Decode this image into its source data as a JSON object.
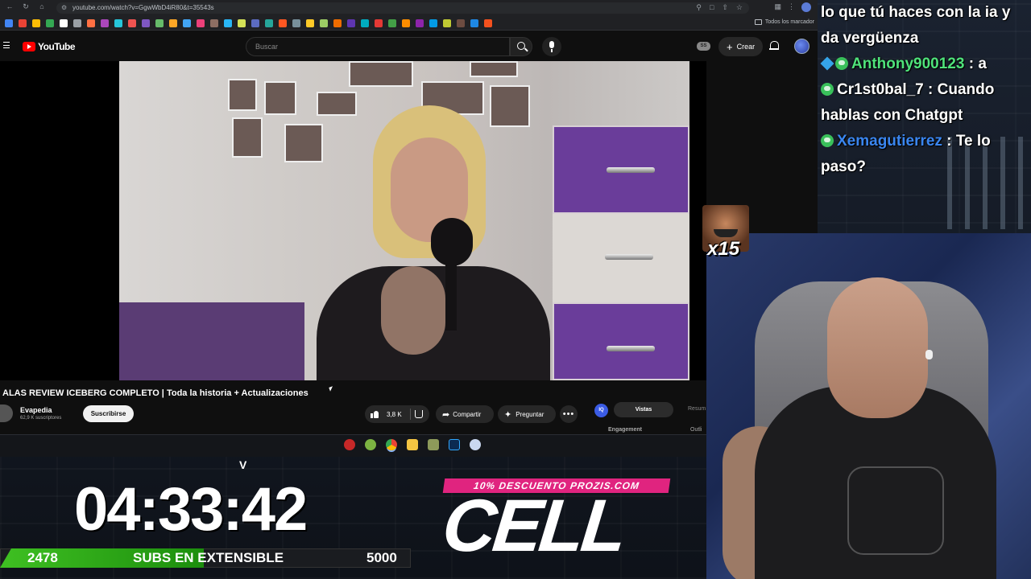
{
  "browser": {
    "url": "youtube.com/watch?v=GgwWbD4iR80&t=35543s",
    "bookmarks_all_label": "Todos los marcador"
  },
  "youtube": {
    "logo_text": "YouTube",
    "search_placeholder": "Buscar",
    "ss_badge": "SS",
    "create_label": "Crear",
    "video": {
      "title": "ALAS REVIEW ICEBERG COMPLETO | Toda la historia + Actualizaciones",
      "channel_name": "Evapedia",
      "subscribers": "62,9 K suscriptores",
      "subscribe_label": "Suscribirse",
      "likes": "3,8 K",
      "share_label": "Compartir",
      "ask_label": "Preguntar",
      "more_label": "•••"
    },
    "side_panel": {
      "iq_badge": "IQ",
      "tab_active": "Vistas",
      "tab_other": "Resum",
      "engagement_label": "Engagement",
      "outline_label": "Outli"
    }
  },
  "chat": {
    "messages": [
      {
        "user": "",
        "text": "lo que tú haces con la ia y da vergüenza"
      },
      {
        "user": "Anthony900123",
        "text": ": a"
      },
      {
        "user": "Cr1st0bal_7",
        "text": ": Cuando hablas con Chatgpt"
      },
      {
        "user": "Xemagutierrez",
        "text": ": Te lo paso?"
      }
    ]
  },
  "emote": {
    "count": "x15"
  },
  "overlay": {
    "v_mark": "V",
    "timer": "04:33:42",
    "subs_current": "2478",
    "subs_label": "SUBS EN EXTENSIBLE",
    "subs_goal": "5000",
    "subs_progress": 0.4956,
    "promo": "10% DESCUENTO PROZIS.COM",
    "logo": "CELL"
  },
  "colors": {
    "youtube_red": "#ff0000",
    "promo_pink": "#e0247f",
    "subs_green": "#3fc022",
    "chat_green": "#4fe27a",
    "chat_blue": "#3a86f0"
  }
}
